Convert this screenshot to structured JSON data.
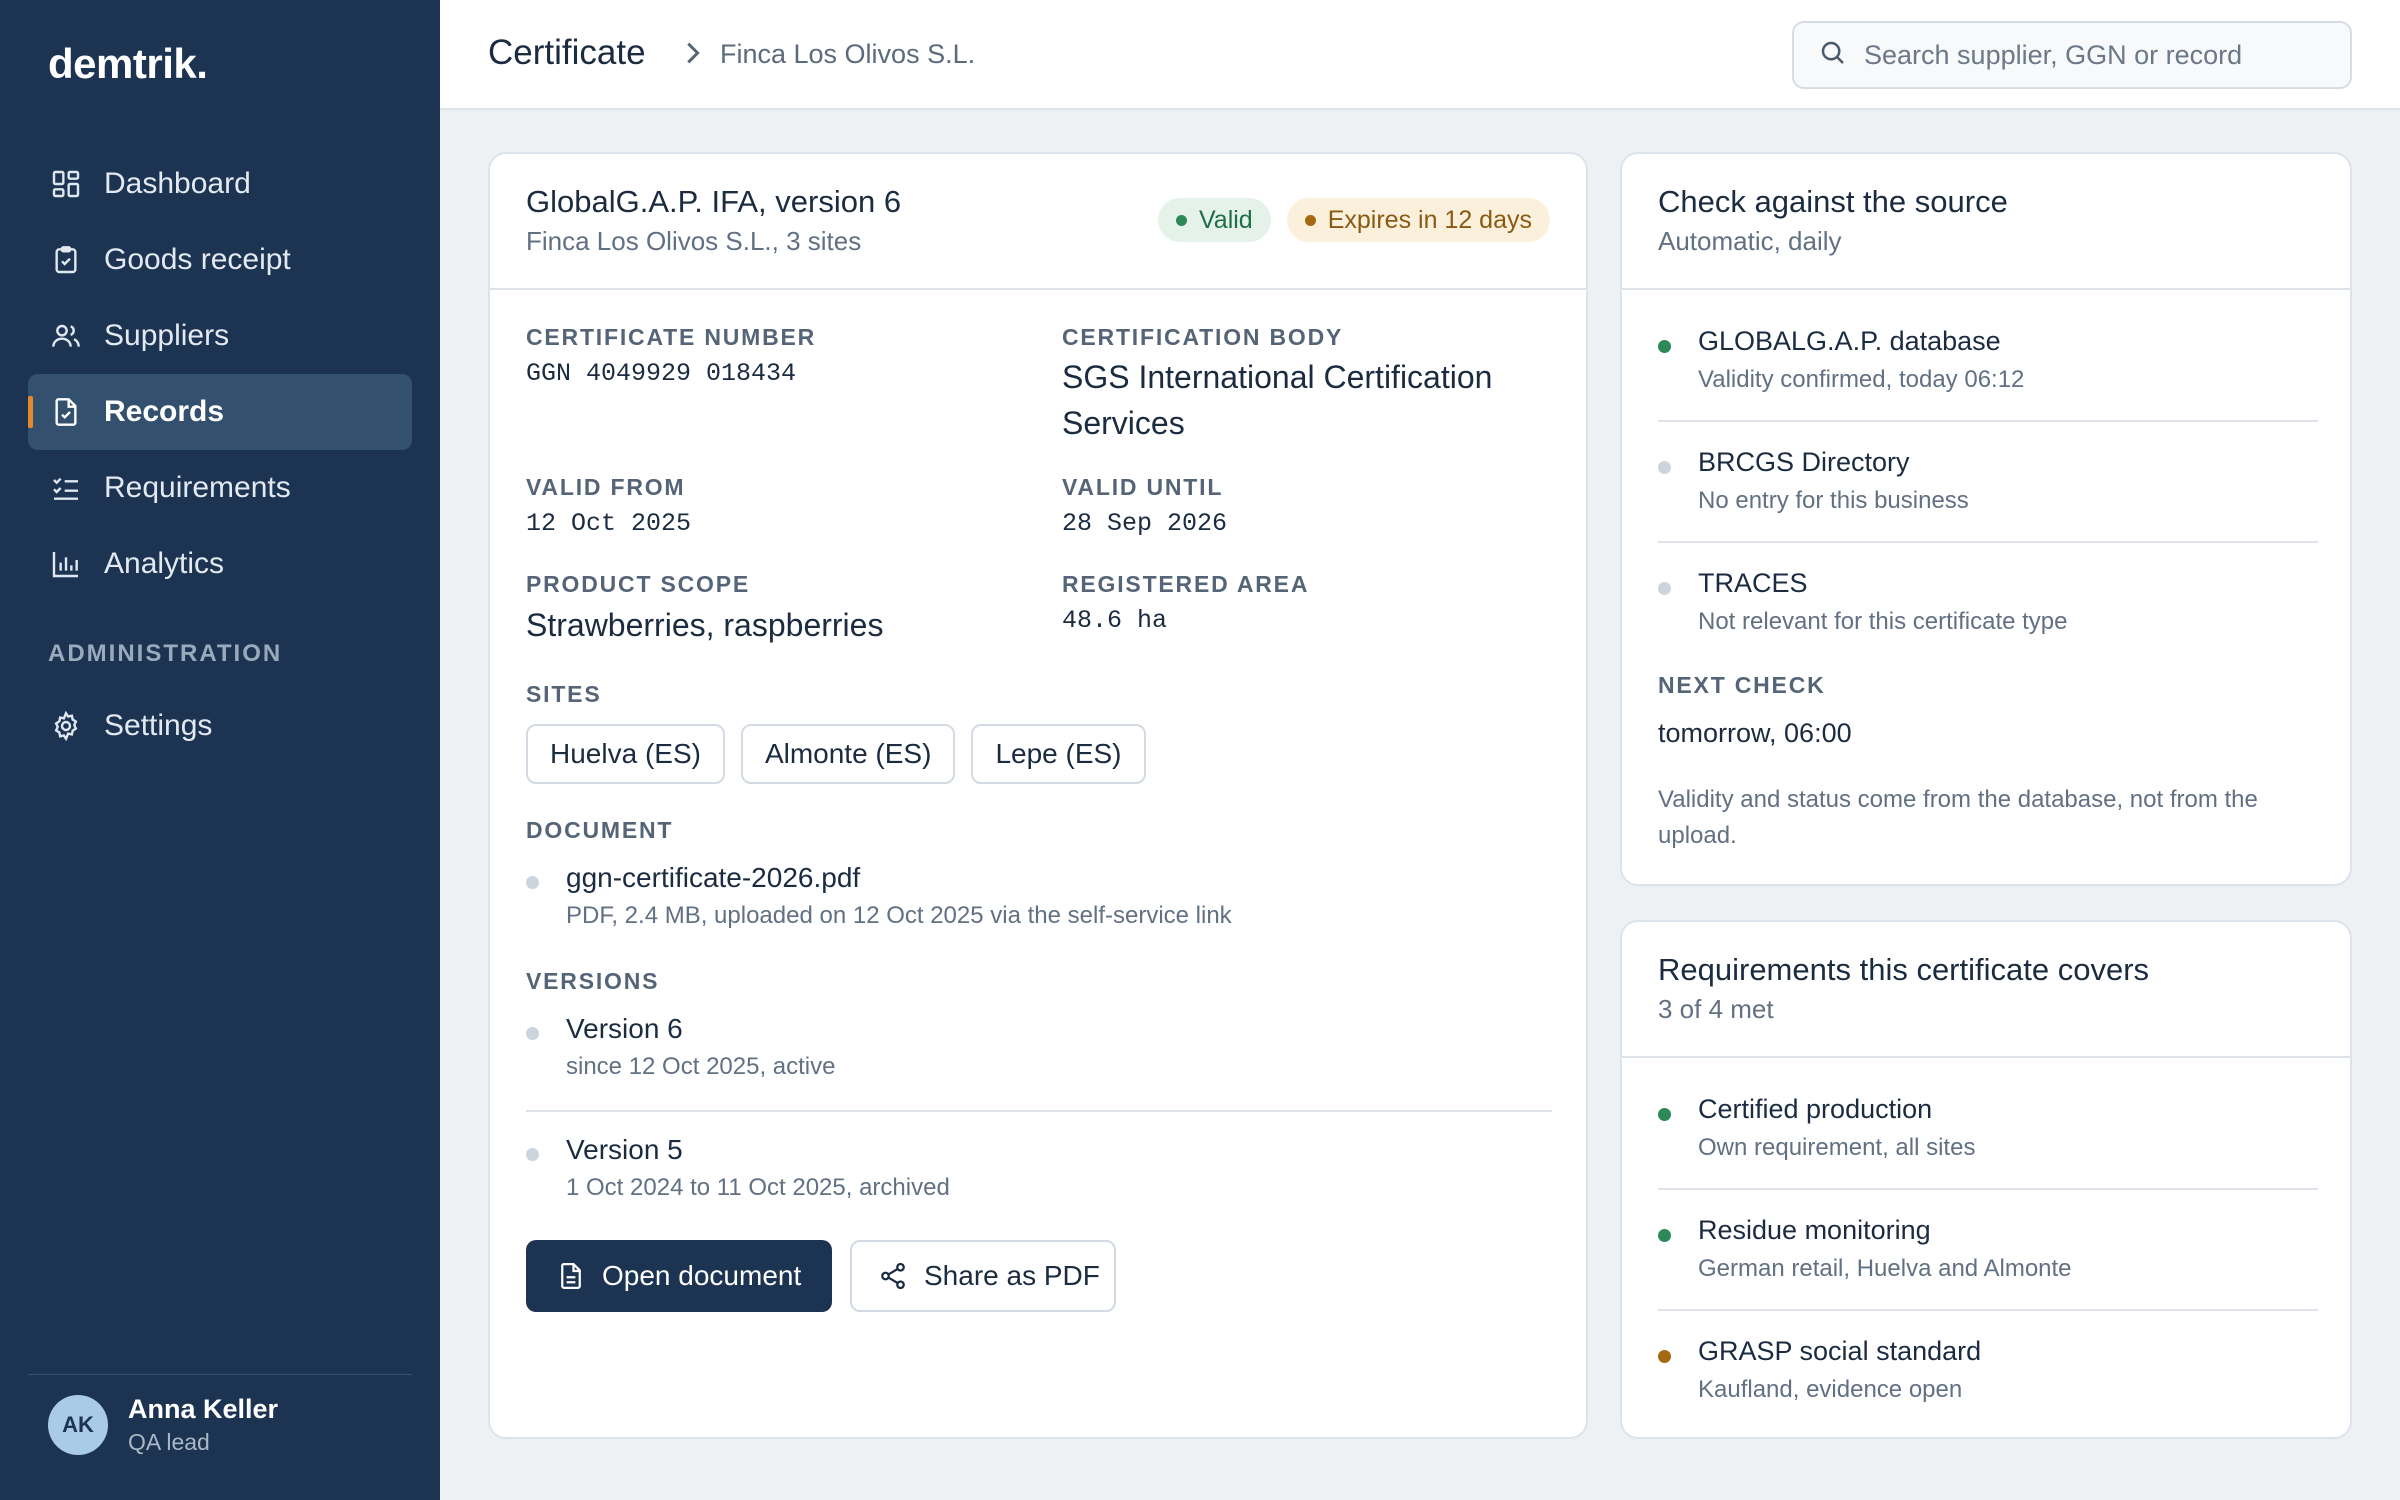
{
  "app": {
    "logo": "demtrik."
  },
  "sidebar": {
    "items": [
      {
        "label": "Dashboard",
        "icon": "dashboard-icon"
      },
      {
        "label": "Goods receipt",
        "icon": "clipboard-check-icon"
      },
      {
        "label": "Suppliers",
        "icon": "users-icon"
      },
      {
        "label": "Records",
        "icon": "document-check-icon",
        "active": true
      },
      {
        "label": "Requirements",
        "icon": "checklist-icon"
      },
      {
        "label": "Analytics",
        "icon": "bar-chart-icon"
      }
    ],
    "section_label": "ADMINISTRATION",
    "admin_items": [
      {
        "label": "Settings",
        "icon": "gear-icon"
      }
    ],
    "user": {
      "initials": "AK",
      "name": "Anna Keller",
      "role": "QA lead"
    }
  },
  "header": {
    "title": "Certificate",
    "breadcrumb": "Finca Los Olivos S.L.",
    "search_placeholder": "Search supplier, GGN or record"
  },
  "certificate": {
    "title": "GlobalG.A.P. IFA, version 6",
    "subtitle": "Finca Los Olivos S.L., 3 sites",
    "badge_valid": "Valid",
    "badge_expiry": "Expires in 12 days",
    "fields": {
      "cert_number_label": "CERTIFICATE NUMBER",
      "cert_number": "GGN 4049929 018434",
      "body_label": "CERTIFICATION BODY",
      "body_line1": "SGS International Certification",
      "body_line2": "Services",
      "valid_from_label": "VALID FROM",
      "valid_from": "12 Oct 2025",
      "valid_until_label": "VALID UNTIL",
      "valid_until": "28 Sep 2026",
      "scope_label": "PRODUCT SCOPE",
      "scope": "Strawberries, raspberries",
      "area_label": "REGISTERED AREA",
      "area": "48.6 ha"
    },
    "sites_label": "SITES",
    "sites": [
      "Huelva (ES)",
      "Almonte (ES)",
      "Lepe (ES)"
    ],
    "document_label": "DOCUMENT",
    "document": {
      "name": "ggn-certificate-2026.pdf",
      "meta": "PDF, 2.4 MB, uploaded on 12 Oct 2025 via the self-service link"
    },
    "versions_label": "VERSIONS",
    "versions": [
      {
        "name": "Version 6",
        "meta": "since 12 Oct 2025, active"
      },
      {
        "name": "Version 5",
        "meta": "1 Oct 2024 to 11 Oct 2025, archived"
      }
    ],
    "btn_open": "Open document",
    "btn_share": "Share as PDF"
  },
  "source_check": {
    "title": "Check against the source",
    "subtitle": "Automatic, daily",
    "items": [
      {
        "name": "GLOBALG.A.P. database",
        "meta": "Validity confirmed, today 06:12",
        "status_color": "#2b8a57"
      },
      {
        "name": "BRCGS Directory",
        "meta": "No entry for this business",
        "status_color": "#ccd4de"
      },
      {
        "name": "TRACES",
        "meta": "Not relevant for this certificate type",
        "status_color": "#ccd4de"
      }
    ],
    "next_check_label": "NEXT CHECK",
    "next_check": "tomorrow, 06:00",
    "note": "Validity and status come from the database, not from the upload."
  },
  "requirements": {
    "title": "Requirements this certificate covers",
    "subtitle": "3 of 4 met",
    "items": [
      {
        "name": "Certified production",
        "meta": "Own requirement, all sites",
        "status_color": "#2b8a57"
      },
      {
        "name": "Residue monitoring",
        "meta": "German retail, Huelva and Almonte",
        "status_color": "#2b8a57"
      },
      {
        "name": "GRASP social standard",
        "meta": "Kaufland, evidence open",
        "status_color": "#a36a12"
      }
    ]
  }
}
